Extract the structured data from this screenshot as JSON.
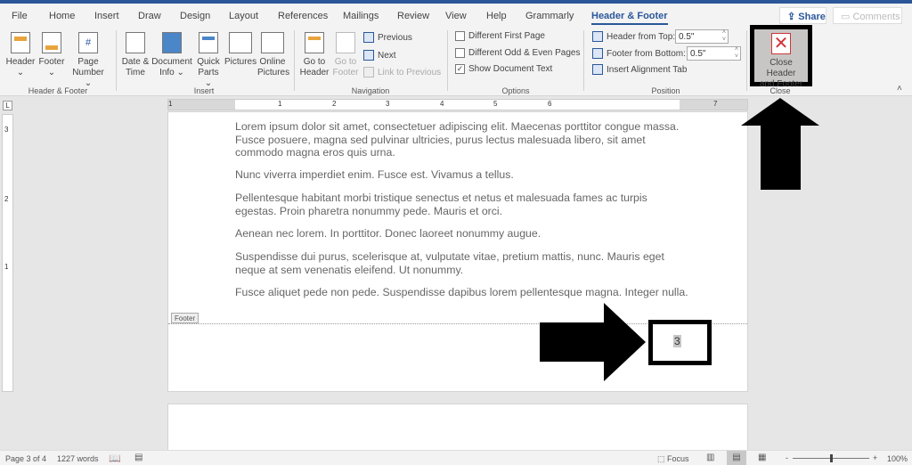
{
  "tabs": [
    "File",
    "Home",
    "Insert",
    "Draw",
    "Design",
    "Layout",
    "References",
    "Mailings",
    "Review",
    "View",
    "Help",
    "Grammarly",
    "Header & Footer"
  ],
  "active_tab": "Header & Footer",
  "share_label": "Share",
  "comments_label": "Comments",
  "ribbon": {
    "header_footer": {
      "label": "Header & Footer",
      "header": "Header",
      "footer": "Footer",
      "page_number_1": "Page",
      "page_number_2": "Number"
    },
    "insert": {
      "label": "Insert",
      "date_1": "Date &",
      "date_2": "Time",
      "docinfo_1": "Document",
      "docinfo_2": "Info",
      "quick_1": "Quick",
      "quick_2": "Parts",
      "pictures": "Pictures",
      "online_1": "Online",
      "online_2": "Pictures"
    },
    "navigation": {
      "label": "Navigation",
      "goto_header_1": "Go to",
      "goto_header_2": "Header",
      "goto_footer_1": "Go to",
      "goto_footer_2": "Footer",
      "previous": "Previous",
      "next": "Next",
      "link_previous": "Link to Previous"
    },
    "options": {
      "label": "Options",
      "different_first": "Different First Page",
      "different_first_checked": false,
      "odd_even": "Different Odd & Even Pages",
      "odd_even_checked": false,
      "show_text": "Show Document Text",
      "show_text_checked": true
    },
    "position": {
      "label": "Position",
      "header_from_top": "Header from Top:",
      "header_value": "0.5\"",
      "footer_from_bottom": "Footer from Bottom:",
      "footer_value": "0.5\"",
      "insert_tab": "Insert Alignment Tab"
    },
    "close": {
      "label": "Close",
      "button_1": "Close Header",
      "button_2": "and Footer"
    }
  },
  "ruler_numbers": [
    "1",
    "1",
    "2",
    "3",
    "4",
    "5",
    "6",
    "7"
  ],
  "vruler_numbers": [
    "3",
    "2",
    "1"
  ],
  "document": {
    "paragraphs": [
      "Lorem ipsum dolor sit amet, consectetuer adipiscing elit. Maecenas porttitor congue massa. Fusce posuere, magna sed pulvinar ultricies, purus lectus malesuada libero, sit amet commodo magna eros quis urna.",
      "Nunc viverra imperdiet enim. Fusce est. Vivamus a tellus.",
      "Pellentesque habitant morbi tristique senectus et netus et malesuada fames ac turpis egestas. Proin pharetra nonummy pede. Mauris et orci.",
      "Aenean nec lorem. In porttitor. Donec laoreet nonummy augue.",
      "Suspendisse dui purus, scelerisque at, vulputate vitae, pretium mattis, nunc. Mauris eget neque at sem venenatis eleifend. Ut nonummy.",
      "Fusce aliquet pede non pede. Suspendisse dapibus lorem pellentesque magna. Integer nulla."
    ],
    "footer_tag": "Footer",
    "page_number": "3"
  },
  "status": {
    "page": "Page 3 of 4",
    "words": "1227 words",
    "focus": "Focus",
    "zoom": "100%",
    "zoom_minus": "-",
    "zoom_plus": "+"
  },
  "colors": {
    "accent": "#2b579a",
    "annotation": "#000000"
  }
}
